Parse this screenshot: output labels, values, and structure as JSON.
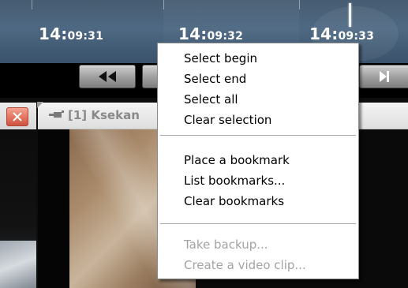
{
  "timeline": {
    "labels": [
      {
        "hm": "14:",
        "min": "09:",
        "sec": "31"
      },
      {
        "hm": "14:",
        "min": "09:",
        "sec": "32"
      },
      {
        "hm": "14:",
        "min": "09:",
        "sec": "33"
      }
    ]
  },
  "controls": {
    "rewind_icon": "rewind-icon",
    "skip_end_icon": "skip-to-end-icon"
  },
  "camera_panel": {
    "title": "[1] Ksekan",
    "icon": "camera-icon",
    "close_icon": "close-icon"
  },
  "context_menu": {
    "group1": [
      "Select begin",
      "Select end",
      "Select all",
      "Clear selection"
    ],
    "group2": [
      "Place a bookmark",
      "List bookmarks...",
      "Clear bookmarks"
    ],
    "group3": [
      "Take backup...",
      "Create a video clip..."
    ],
    "group3_disabled": true
  },
  "colors": {
    "timeline_bg": "#4a6682",
    "menu_bg": "#ffffff",
    "disabled_text": "#a3a3a3",
    "close_button": "#e0705b"
  }
}
